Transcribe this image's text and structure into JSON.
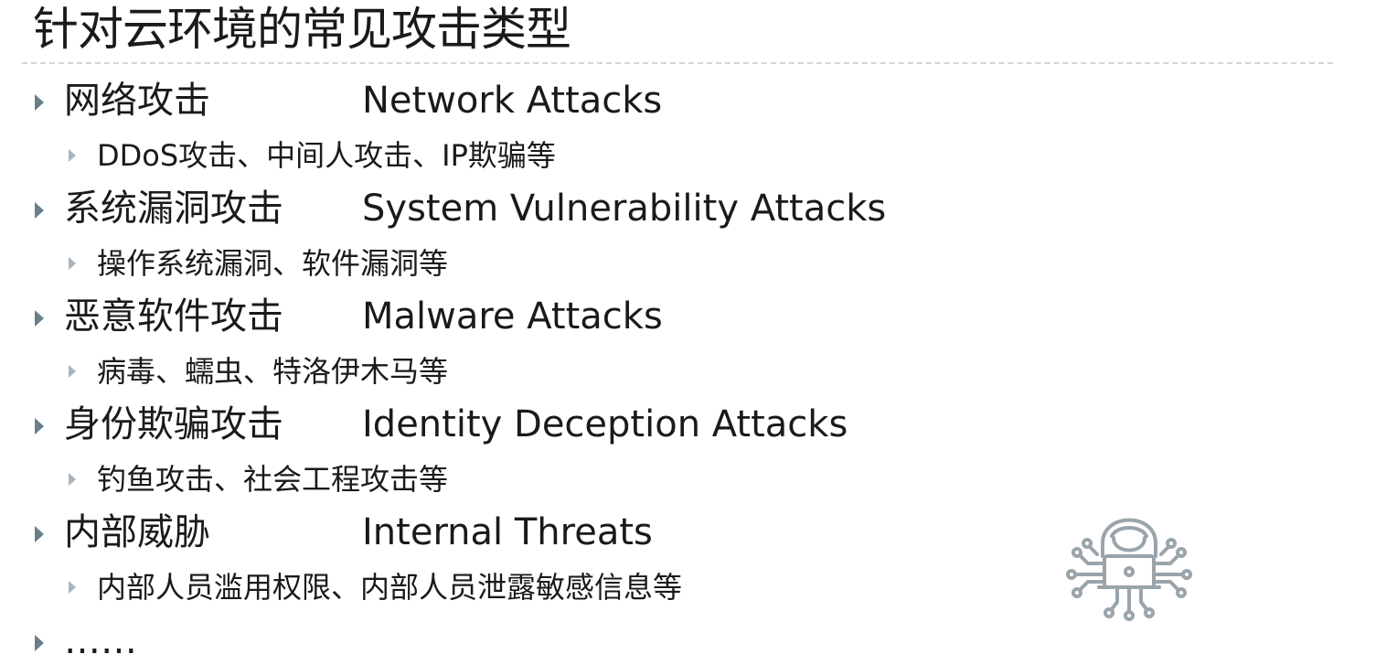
{
  "title": "针对云环境的常见攻击类型",
  "items": [
    {
      "zh": "网络攻击",
      "en": "Network Attacks",
      "sub": "DDoS攻击、中间人攻击、IP欺骗等"
    },
    {
      "zh": "系统漏洞攻击",
      "en": "System Vulnerability Attacks",
      "sub": "操作系统漏洞、软件漏洞等"
    },
    {
      "zh": "恶意软件攻击",
      "en": "Malware Attacks",
      "sub": "病毒、蠕虫、特洛伊木马等"
    },
    {
      "zh": "身份欺骗攻击",
      "en": "Identity Deception Attacks",
      "sub": "钓鱼攻击、社会工程攻击等"
    },
    {
      "zh": "内部威胁",
      "en": "Internal Threats",
      "sub": "内部人员滥用权限、内部人员泄露敏感信息等"
    }
  ],
  "more": "……",
  "icons": {
    "bullet": "triangle-bullet-icon",
    "illustration": "hacker-laptop-icon"
  },
  "colors": {
    "bullet": "#6b7e8c",
    "sub_bullet": "#a7b4bd",
    "icon": "#9aa4ab",
    "rule": "#d6d6d6"
  }
}
